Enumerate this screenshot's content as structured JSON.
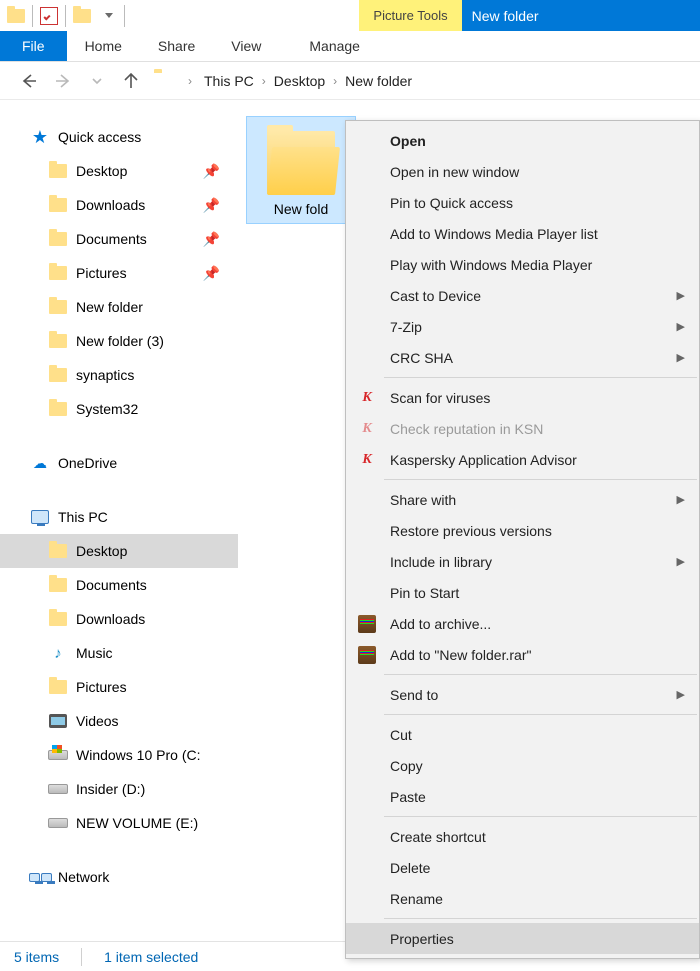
{
  "title_window": "New folder",
  "ribbon_context_label": "Picture Tools",
  "tabs": {
    "file": "File",
    "home": "Home",
    "share": "Share",
    "view": "View",
    "manage": "Manage"
  },
  "breadcrumbs": {
    "root": "This PC",
    "mid": "Desktop",
    "leaf": "New folder"
  },
  "nav_pane": {
    "quick_access": "Quick access",
    "quick_items": [
      {
        "label": "Desktop",
        "pinned": true
      },
      {
        "label": "Downloads",
        "pinned": true
      },
      {
        "label": "Documents",
        "pinned": true
      },
      {
        "label": "Pictures",
        "pinned": true
      },
      {
        "label": "New folder",
        "pinned": false
      },
      {
        "label": "New folder (3)",
        "pinned": false
      },
      {
        "label": "synaptics",
        "pinned": false
      },
      {
        "label": "System32",
        "pinned": false
      }
    ],
    "onedrive": "OneDrive",
    "this_pc": "This PC",
    "pc_items": [
      {
        "label": "Desktop"
      },
      {
        "label": "Documents"
      },
      {
        "label": "Downloads"
      },
      {
        "label": "Music"
      },
      {
        "label": "Pictures"
      },
      {
        "label": "Videos"
      },
      {
        "label": "Windows 10 Pro (C:"
      },
      {
        "label": "Insider (D:)"
      },
      {
        "label": "NEW VOLUME (E:)"
      }
    ],
    "network": "Network"
  },
  "content": {
    "selected_item_label": "New fold"
  },
  "context_menu": {
    "open": "Open",
    "open_new_window": "Open in new window",
    "pin_quick": "Pin to Quick access",
    "add_wmp_list": "Add to Windows Media Player list",
    "play_wmp": "Play with Windows Media Player",
    "cast": "Cast to Device",
    "sevenzip": "7-Zip",
    "crcsha": "CRC SHA",
    "scan": "Scan for viruses",
    "reputation": "Check reputation in KSN",
    "kas_advisor": "Kaspersky Application Advisor",
    "share_with": "Share with",
    "restore_prev": "Restore previous versions",
    "include_lib": "Include in library",
    "pin_start": "Pin to Start",
    "add_archive": "Add to archive...",
    "add_rar": "Add to \"New folder.rar\"",
    "send_to": "Send to",
    "cut": "Cut",
    "copy": "Copy",
    "paste": "Paste",
    "create_shortcut": "Create shortcut",
    "delete": "Delete",
    "rename": "Rename",
    "properties": "Properties"
  },
  "status": {
    "count": "5 items",
    "selection": "1 item selected"
  }
}
